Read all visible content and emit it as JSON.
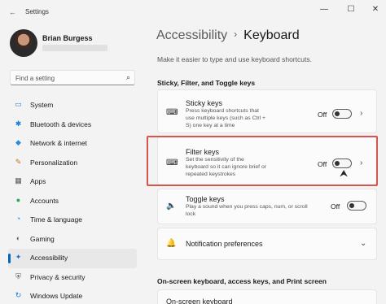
{
  "window": {
    "title": "Settings",
    "app_icon": "back-arrow-icon",
    "controls": [
      "—",
      "☐",
      "✕"
    ]
  },
  "profile": {
    "name": "Brian Burgess"
  },
  "search": {
    "placeholder": "Find a setting"
  },
  "sidebar": {
    "items": [
      {
        "label": "System",
        "icon": "system-icon",
        "glyph": "▭",
        "color": "#2b7fd1"
      },
      {
        "label": "Bluetooth & devices",
        "icon": "bluetooth-icon",
        "glyph": "✱",
        "color": "#1f78d1"
      },
      {
        "label": "Network & internet",
        "icon": "network-icon",
        "glyph": "◆",
        "color": "#2a8ad8"
      },
      {
        "label": "Personalization",
        "icon": "brush-icon",
        "glyph": "✎",
        "color": "#c0741c"
      },
      {
        "label": "Apps",
        "icon": "apps-icon",
        "glyph": "▦",
        "color": "#5a5a5a"
      },
      {
        "label": "Accounts",
        "icon": "accounts-icon",
        "glyph": "●",
        "color": "#2aa35b"
      },
      {
        "label": "Time & language",
        "icon": "time-language-icon",
        "glyph": "◔",
        "color": "#1f78d1"
      },
      {
        "label": "Gaming",
        "icon": "gaming-icon",
        "glyph": "◐",
        "color": "#666666"
      },
      {
        "label": "Accessibility",
        "icon": "accessibility-icon",
        "glyph": "✦",
        "color": "#1f6fd1"
      },
      {
        "label": "Privacy & security",
        "icon": "shield-icon",
        "glyph": "⛨",
        "color": "#5a5a5a"
      },
      {
        "label": "Windows Update",
        "icon": "windows-update-icon",
        "glyph": "↻",
        "color": "#1f78d1"
      }
    ],
    "active_index": 8
  },
  "header": {
    "parent": "Accessibility",
    "separator": "›",
    "current": "Keyboard",
    "subtitle": "Make it easier to type and use keyboard shortcuts."
  },
  "sections": {
    "sticky_filter_toggle": "Sticky, Filter, and Toggle keys",
    "onscreen": "On-screen keyboard, access keys, and Print screen"
  },
  "settings": {
    "sticky": {
      "title": "Sticky keys",
      "desc": "Press keyboard shortcuts that use multiple keys (such as Ctrl + S) one key at a time",
      "state": "Off",
      "icon": "sticky-keys-icon",
      "glyph": "⌨"
    },
    "filter": {
      "title": "Filter keys",
      "desc": "Set the sensitivity of the keyboard so it can ignore brief or repeated keystrokes",
      "state": "Off",
      "icon": "filter-keys-icon",
      "glyph": "⌨"
    },
    "toggle": {
      "title": "Toggle keys",
      "desc": "Play a sound when you press caps, num, or scroll lock",
      "state": "Off",
      "icon": "speaker-icon",
      "glyph": "🔈"
    },
    "notification": {
      "title": "Notification preferences",
      "icon": "bell-icon",
      "glyph": "🔔"
    },
    "onscreen_keyboard": {
      "title": "On-screen keyboard"
    }
  },
  "colors": {
    "accent": "#0067c0",
    "highlight_border": "#d9534f"
  }
}
